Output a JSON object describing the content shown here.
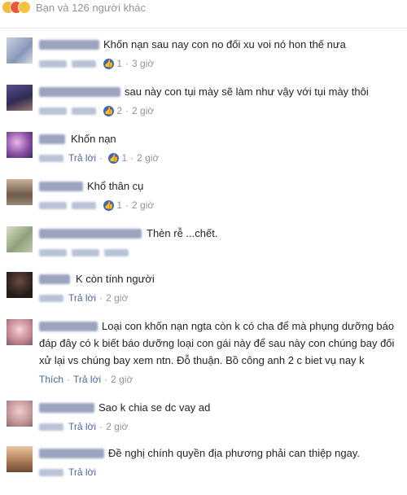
{
  "reactions": {
    "summary": "Bạn và 126 người khác"
  },
  "comments": [
    {
      "text": "Khốn nạn sau nay con no đối xu voi nó hon thế nưa",
      "reply": "",
      "likes": "1",
      "time": "3 giờ"
    },
    {
      "text": "sau này con tụi mày sẽ làm như vậy với tụi mày thôi",
      "reply": "",
      "likes": "2",
      "time": "2 giờ"
    },
    {
      "text": "Khốn nạn",
      "reply": "Trả lời",
      "likes": "1",
      "time": "2 giờ"
    },
    {
      "text": "Khổ thân cụ",
      "reply": "",
      "likes": "1",
      "time": "2 giờ"
    },
    {
      "text": "Thèn rễ ...chết.",
      "reply": "",
      "likes": "",
      "time": ""
    },
    {
      "text": "K còn tính người",
      "reply": "Trả lời",
      "likes": "",
      "time": "2 giờ"
    },
    {
      "lines": [
        "Loại con khốn nạn ngta còn k có cha để mà phụng dưỡng báo",
        "đáp đây có k biết báo dưỡng loại con gái này để sau này con chúng bay đối",
        "xử lại vs chúng bay xem ntn. Đỗ thuận. Bồ công anh 2 c biet vụ nay k"
      ],
      "like": "Thích",
      "reply": "Trả lời",
      "time": "2 giờ"
    },
    {
      "text": "Sao k chia se dc vay ad",
      "reply": "Trả lời",
      "likes": "",
      "time": "2 giờ"
    },
    {
      "text": "Đề nghị chính quyền địa phương phải can thiệp ngay.",
      "reply": "Trả lời",
      "likes": "",
      "time": ""
    }
  ],
  "colors": {
    "meta": "#90949c",
    "link": "#4b67a1",
    "like_badge": "#4267b2"
  },
  "icons": {
    "like_badge": "like-thumb-icon"
  }
}
